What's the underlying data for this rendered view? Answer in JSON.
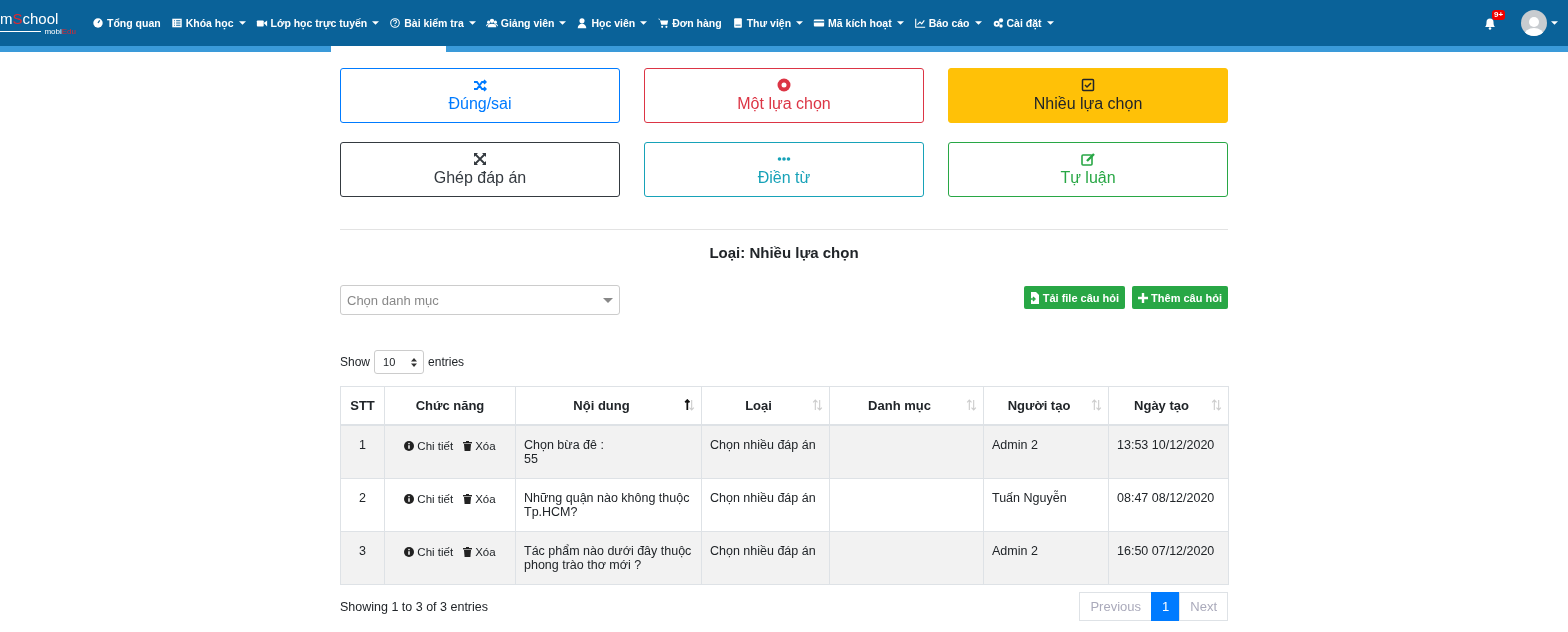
{
  "navbar": {
    "logo": {
      "title_start": "m",
      "title_accent": "S",
      "title_end": "chool",
      "subtitle_start": "mobi",
      "subtitle_accent": "Edu"
    },
    "items": [
      {
        "label": "Tổng quan",
        "dropdown": false
      },
      {
        "label": "Khóa học",
        "dropdown": true
      },
      {
        "label": "Lớp học trực tuyến",
        "dropdown": true
      },
      {
        "label": "Bài kiểm tra",
        "dropdown": true
      },
      {
        "label": "Giảng viên",
        "dropdown": true
      },
      {
        "label": "Học viên",
        "dropdown": true
      },
      {
        "label": "Đơn hàng",
        "dropdown": false
      },
      {
        "label": "Thư viện",
        "dropdown": true
      },
      {
        "label": "Mã kích hoạt",
        "dropdown": true
      },
      {
        "label": "Báo cáo",
        "dropdown": true
      },
      {
        "label": "Cài đặt",
        "dropdown": true
      }
    ],
    "notification_badge": "9+"
  },
  "question_types": [
    {
      "label": "Đúng/sai",
      "kind": "primary",
      "selected": false
    },
    {
      "label": "Một lựa chọn",
      "kind": "danger",
      "selected": false
    },
    {
      "label": "Nhiều lựa chọn",
      "kind": "warning",
      "selected": true
    },
    {
      "label": "Ghép đáp án",
      "kind": "dark",
      "selected": false
    },
    {
      "label": "Điền từ",
      "kind": "info",
      "selected": false
    },
    {
      "label": "Tự luận",
      "kind": "success",
      "selected": false
    }
  ],
  "section_title": "Loại: Nhiều lựa chọn",
  "category_select": {
    "placeholder": "Chọn danh mục"
  },
  "actions": [
    "Tải file câu hỏi",
    "Thêm câu hỏi"
  ],
  "length_control": {
    "prefix": "Show",
    "value": "10",
    "suffix": "entries"
  },
  "table": {
    "columns": [
      {
        "label": "STT",
        "sortable": false
      },
      {
        "label": "Chức năng",
        "sortable": false
      },
      {
        "label": "Nội dung",
        "sortable": true,
        "sorted_ascending": true
      },
      {
        "label": "Loại",
        "sortable": true,
        "sorted_ascending": false
      },
      {
        "label": "Danh mục",
        "sortable": true,
        "sorted_ascending": false
      },
      {
        "label": "Người tạo",
        "sortable": true,
        "sorted_ascending": false
      },
      {
        "label": "Ngày tạo",
        "sortable": true,
        "sorted_ascending": false
      }
    ],
    "rows": [
      {
        "stt": "1",
        "actions": [
          "Chi tiết",
          "Xóa"
        ],
        "content": [
          "Chọn bừa đê :",
          "55"
        ],
        "type": "Chọn nhiều đáp án",
        "creator": "Admin 2",
        "date": "13:53 10/12/2020"
      },
      {
        "stt": "2",
        "actions": [
          "Chi tiết",
          "Xóa"
        ],
        "content": [
          "Những quận nào không thuộc Tp.HCM?"
        ],
        "type": "Chọn nhiều đáp án",
        "creator": "Tuấn Nguyễn",
        "date": "08:47 08/12/2020"
      },
      {
        "stt": "3",
        "actions": [
          "Chi tiết",
          "Xóa"
        ],
        "content": [
          "Tác phẩm nào dưới đây thuộc phong trào thơ mới ?"
        ],
        "type": "Chọn nhiều đáp án",
        "creator": "Admin 2",
        "date": "16:50 07/12/2020"
      }
    ]
  },
  "table_info": "Showing 1 to 3 of 3 entries",
  "pagination": [
    {
      "label": "Previous",
      "selected": false,
      "disabled": true
    },
    {
      "label": "1",
      "selected": true,
      "disabled": false
    },
    {
      "label": "Next",
      "selected": false,
      "disabled": true
    }
  ]
}
